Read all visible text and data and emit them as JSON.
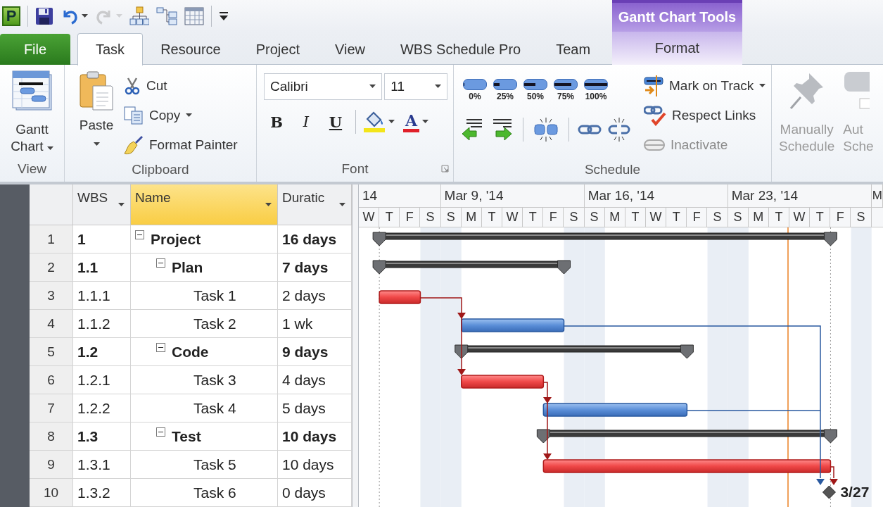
{
  "quick_access": {
    "app_icon": "P",
    "redo": {
      "disabled": true
    }
  },
  "contextual_tab_group": {
    "title": "Gantt Chart Tools"
  },
  "tabs": [
    {
      "label": "File",
      "kind": "file",
      "selected": false
    },
    {
      "label": "Task",
      "kind": "normal",
      "selected": true
    },
    {
      "label": "Resource",
      "kind": "normal",
      "selected": false
    },
    {
      "label": "Project",
      "kind": "normal",
      "selected": false
    },
    {
      "label": "View",
      "kind": "normal",
      "selected": false
    },
    {
      "label": "WBS Schedule Pro",
      "kind": "normal",
      "selected": false
    },
    {
      "label": "Team",
      "kind": "normal",
      "selected": false
    },
    {
      "label": "Format",
      "kind": "contextual",
      "selected": false
    }
  ],
  "ribbon": {
    "view": {
      "label": "View",
      "button": {
        "lines": [
          "Gantt",
          "Chart"
        ],
        "dropdown": true
      }
    },
    "clipboard": {
      "label": "Clipboard",
      "paste": {
        "label": "Paste",
        "dropdown": true
      },
      "items": [
        {
          "label": "Cut",
          "dropdown": false
        },
        {
          "label": "Copy",
          "dropdown": true
        },
        {
          "label": "Format Painter",
          "dropdown": false
        }
      ]
    },
    "font": {
      "label": "Font",
      "family": "Calibri",
      "size": "11",
      "styles": [
        {
          "glyph": "B",
          "kind": "bold"
        },
        {
          "glyph": "I",
          "kind": "italic"
        },
        {
          "glyph": "U",
          "kind": "underline"
        }
      ],
      "font_color_glyph": "A"
    },
    "schedule": {
      "label": "Schedule",
      "percent_buttons": [
        {
          "label": "0%",
          "level": 0
        },
        {
          "label": "25%",
          "level": 0.25
        },
        {
          "label": "50%",
          "level": 0.5
        },
        {
          "label": "75%",
          "level": 0.75
        },
        {
          "label": "100%",
          "level": 1
        }
      ],
      "commands": [
        {
          "label": "Mark on Track",
          "dropdown": true,
          "disabled": false
        },
        {
          "label": "Respect Links",
          "dropdown": false,
          "disabled": false
        },
        {
          "label": "Inactivate",
          "dropdown": false,
          "disabled": true
        }
      ]
    },
    "tasks": {
      "buttons": [
        {
          "lines": [
            "Manually",
            "Schedule"
          ],
          "disabled": true
        },
        {
          "lines": [
            "Aut",
            "Sche"
          ],
          "disabled": true
        }
      ]
    }
  },
  "grid": {
    "columns": [
      {
        "label": "WBS",
        "selected": false
      },
      {
        "label": "Name",
        "selected": true
      },
      {
        "label": "Duratic",
        "selected": false
      }
    ],
    "timescale": [
      {
        "label": "14",
        "days": [
          {
            "letter": "W",
            "nonworking": false
          },
          {
            "letter": "T",
            "nonworking": false
          },
          {
            "letter": "F",
            "nonworking": false
          },
          {
            "letter": "S",
            "nonworking": true
          }
        ]
      },
      {
        "label": "Mar 9, '14",
        "days": [
          {
            "letter": "S",
            "nonworking": true
          },
          {
            "letter": "M",
            "nonworking": false
          },
          {
            "letter": "T",
            "nonworking": false
          },
          {
            "letter": "W",
            "nonworking": false
          },
          {
            "letter": "T",
            "nonworking": false
          },
          {
            "letter": "F",
            "nonworking": false
          },
          {
            "letter": "S",
            "nonworking": true
          }
        ]
      },
      {
        "label": "Mar 16, '14",
        "days": [
          {
            "letter": "S",
            "nonworking": true
          },
          {
            "letter": "M",
            "nonworking": false
          },
          {
            "letter": "T",
            "nonworking": false
          },
          {
            "letter": "W",
            "nonworking": false
          },
          {
            "letter": "T",
            "nonworking": false
          },
          {
            "letter": "F",
            "nonworking": false
          },
          {
            "letter": "S",
            "nonworking": true
          }
        ]
      },
      {
        "label": "Mar 23, '14",
        "days": [
          {
            "letter": "S",
            "nonworking": true
          },
          {
            "letter": "M",
            "nonworking": false
          },
          {
            "letter": "T",
            "nonworking": false
          },
          {
            "letter": "W",
            "nonworking": false
          },
          {
            "letter": "T",
            "nonworking": false
          },
          {
            "letter": "F",
            "nonworking": false
          },
          {
            "letter": "S",
            "nonworking": true
          }
        ]
      },
      {
        "label": "M"
      }
    ],
    "tasks": [
      {
        "row": "1",
        "wbs": "1",
        "name": "Project",
        "duration": "16 days",
        "kind": "summary",
        "expanded": true,
        "children": [
          {
            "row": "2",
            "wbs": "1.1",
            "name": "Plan",
            "duration": "7 days",
            "kind": "summary",
            "expanded": true,
            "children": [
              {
                "row": "3",
                "wbs": "1.1.1",
                "name": "Task 1",
                "duration": "2 days",
                "kind": "critical"
              },
              {
                "row": "4",
                "wbs": "1.1.2",
                "name": "Task 2",
                "duration": "1 wk",
                "kind": "task"
              }
            ]
          },
          {
            "row": "5",
            "wbs": "1.2",
            "name": "Code",
            "duration": "9 days",
            "kind": "summary",
            "expanded": true,
            "children": [
              {
                "row": "6",
                "wbs": "1.2.1",
                "name": "Task 3",
                "duration": "4 days",
                "kind": "critical"
              },
              {
                "row": "7",
                "wbs": "1.2.2",
                "name": "Task 4",
                "duration": "5 days",
                "kind": "task"
              }
            ]
          },
          {
            "row": "8",
            "wbs": "1.3",
            "name": "Test",
            "duration": "10 days",
            "kind": "summary",
            "expanded": true,
            "children": [
              {
                "row": "9",
                "wbs": "1.3.1",
                "name": "Task 5",
                "duration": "10 days",
                "kind": "critical"
              },
              {
                "row": "10",
                "wbs": "1.3.2",
                "name": "Task 6",
                "duration": "0 days",
                "kind": "milestone",
                "bar_label": "3/27"
              }
            ]
          }
        ]
      }
    ]
  }
}
